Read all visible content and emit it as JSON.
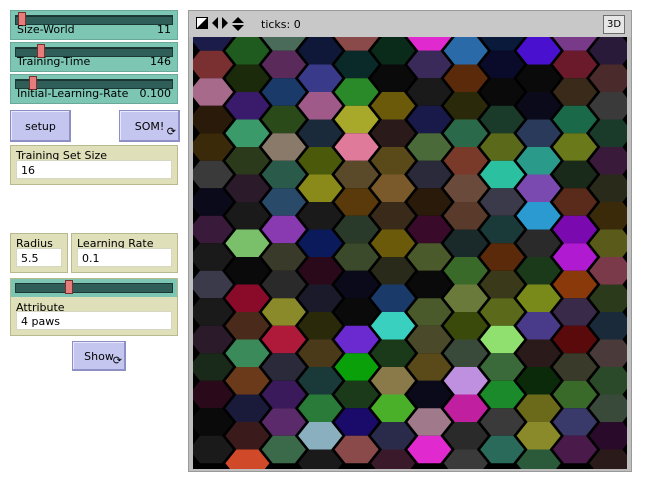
{
  "sliders": [
    {
      "label": "Size-World",
      "value": "11",
      "fraction": 0.02
    },
    {
      "label": "Training-Time",
      "value": "146",
      "fraction": 0.14
    },
    {
      "label": "Initial-Learning-Rate",
      "value": "0.100",
      "fraction": 0.06
    }
  ],
  "buttons": {
    "setup": "setup",
    "som": "SOM!",
    "show": "Show"
  },
  "inputs": {
    "training_set_size": {
      "label": "Training Set Size",
      "value": "16"
    },
    "attribute": {
      "label": "Attribute",
      "value": "4 paws"
    }
  },
  "monitors": {
    "radius": {
      "label": "Radius",
      "value": "5.5"
    },
    "learning_rate": {
      "label": "Learning Rate",
      "value": "0.1"
    }
  },
  "attribute_slider_fraction": 0.36,
  "view": {
    "ticks": "ticks: 0",
    "three_d": "3D"
  },
  "hex_colors": [
    [
      "#1c1c4a",
      "#1f5a1f",
      "#4a6a5a",
      "#10183a",
      "#8a4a4a",
      "#0a2a1a",
      "#e02ad0",
      "#2a6aa8",
      "#0a1a3a",
      "#4a10d0",
      "#7a3a8a",
      "#2a1a3a"
    ],
    [
      "#7a3030",
      "#1a2a0a",
      "#5a2a5a",
      "#3a3a8a",
      "#0a2a2a",
      "#0a0a0a",
      "#3a2a5a",
      "#5a2a0a",
      "#0a0a2a",
      "#0a0a0a",
      "#6a1a2a",
      "#4a2a2a"
    ],
    [
      "#a86a8a",
      "#3a1a6a",
      "#1a3a6a",
      "#a05a8a",
      "#2a8a2a",
      "#6a5a0a",
      "#1a1a1a",
      "#2a2a0a",
      "#0a0a0a",
      "#0a0a1a",
      "#3a2a1a",
      "#3a3a3a"
    ],
    [
      "#2a1a0a",
      "#3a9a6a",
      "#2a4a1a",
      "#1a2a3a",
      "#a8a82a",
      "#2a1a1a",
      "#1a1a4a",
      "#2a6a4a",
      "#1a3a2a",
      "#2a3a5a",
      "#1a6a4a",
      "#1a3a2a"
    ],
    [
      "#3a2a0a",
      "#2a3a1a",
      "#8a7a6a",
      "#4a5a0a",
      "#e07a9a",
      "#5a4a1a",
      "#4a6a3a",
      "#7a3a2a",
      "#5a6a1a",
      "#2a9a8a",
      "#6a7a1a",
      "#3a1a3a"
    ],
    [
      "#3a3a3a",
      "#2a1a2a",
      "#2a5a4a",
      "#8a8a1a",
      "#5a4a2a",
      "#7a5a2a",
      "#2a2a3a",
      "#6a4a3a",
      "#2ac0a0",
      "#7a4ab0",
      "#1a2a1a",
      "#2a2a1a"
    ],
    [
      "#0a0a1a",
      "#1a1a1a",
      "#2a4a6a",
      "#1a1a1a",
      "#5a3a0a",
      "#3a2a1a",
      "#2a1a0a",
      "#5a3a2a",
      "#3a3a4a",
      "#2a9ad0",
      "#5a2a1a",
      "#3a2a0a"
    ],
    [
      "#3a1a3a",
      "#7ac06a",
      "#8a3ab0",
      "#0a1a5a",
      "#2a3a2a",
      "#6a5a0a",
      "#3a0a2a",
      "#1a2a2a",
      "#1a3a3a",
      "#2a2a2a",
      "#7a0ab0",
      "#5a5a1a"
    ],
    [
      "#1a1a1a",
      "#0a0a0a",
      "#3a3a2a",
      "#2a0a1a",
      "#3a4a2a",
      "#2a2a1a",
      "#4a5a2a",
      "#3a6a2a",
      "#5a2a0a",
      "#1a3a1a",
      "#b01ad0",
      "#7a3a4a"
    ],
    [
      "#3a3a4a",
      "#8a0a2a",
      "#2a2a2a",
      "#1a1a2a",
      "#0a0a1a",
      "#1a3a6a",
      "#0a0a0a",
      "#6a7a3a",
      "#3a3a1a",
      "#7a8a1a",
      "#8a3a0a",
      "#2a3a1a"
    ],
    [
      "#1a1a1a",
      "#4a2a1a",
      "#8a8a2a",
      "#2a2a0a",
      "#0a0a0a",
      "#3ad0c0",
      "#4a5a2a",
      "#3a4a0a",
      "#5a6a1a",
      "#4a3a8a",
      "#3a2a4a",
      "#1a2a3a"
    ],
    [
      "#2a1a2a",
      "#3a8a5a",
      "#b01a3a",
      "#4a3a1a",
      "#6a2ad0",
      "#1a3a1a",
      "#4a4a2a",
      "#3a4a3a",
      "#90e070",
      "#2a1a1a",
      "#5a0a0a",
      "#4a3a3a"
    ],
    [
      "#1a2a1a",
      "#6a3a1a",
      "#2a2a3a",
      "#1a3a3a",
      "#0aa00a",
      "#8a7a4a",
      "#5a4a1a",
      "#c090e0",
      "#3a6a3a",
      "#0a2a0a",
      "#3a3a2a",
      "#2a4a2a"
    ],
    [
      "#2a0a1a",
      "#1a1a3a",
      "#3a1a5a",
      "#2a7a3a",
      "#1a3a1a",
      "#4ab02a",
      "#0a0a1a",
      "#c020a0",
      "#1a8a2a",
      "#6a6a1a",
      "#3a6a2a",
      "#3a4a3a"
    ],
    [
      "#0a0a0a",
      "#3a1a1a",
      "#5a2a6a",
      "#8ab0c0",
      "#1a0a6a",
      "#2a2a4a",
      "#a07a8a",
      "#2a2a2a",
      "#3a3a3a",
      "#8a8a2a",
      "#3a3a6a",
      "#2a0a2a"
    ],
    [
      "#1a1a1a",
      "#d04a2a",
      "#3a6a4a",
      "#1a1a1a",
      "#8a4a4a",
      "#3a1a2a",
      "#e02ad0",
      "#3a3a3a",
      "#2a6a5a",
      "#2a5a3a",
      "#4a1a4a",
      "#2a1a1a"
    ]
  ]
}
